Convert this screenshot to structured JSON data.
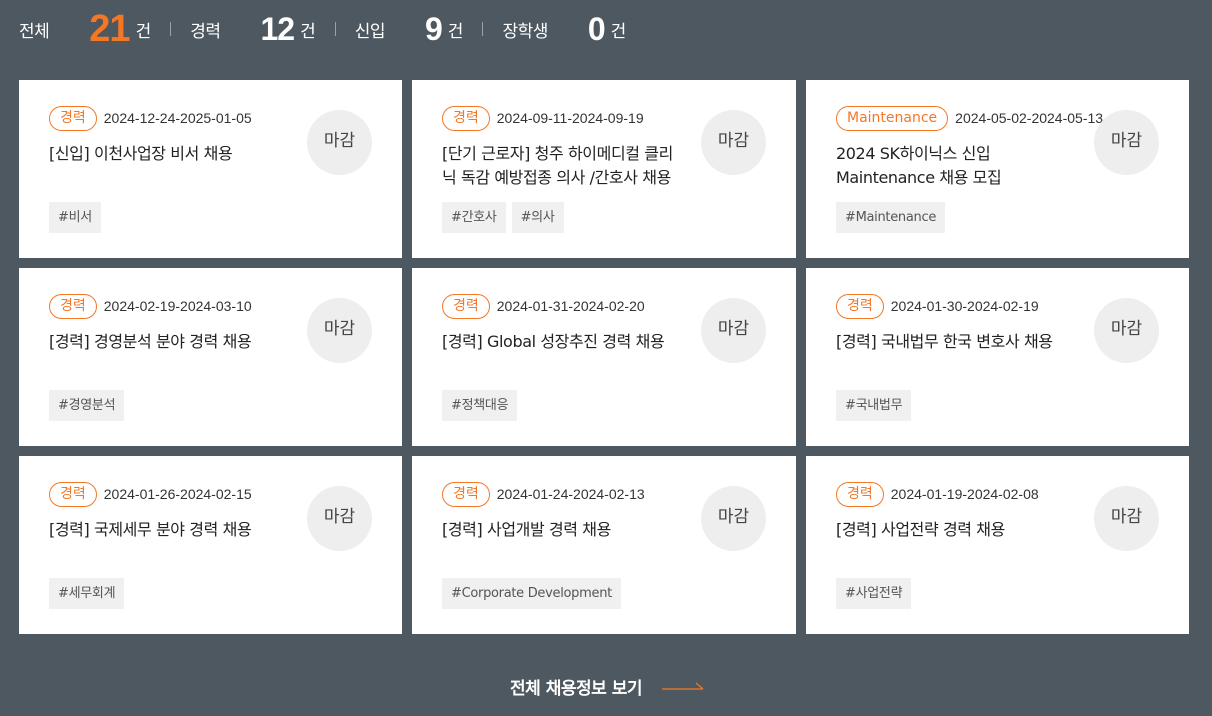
{
  "stats": [
    {
      "label": "전체",
      "count": "21",
      "unit": "건"
    },
    {
      "label": "경력",
      "count": "12",
      "unit": "건"
    },
    {
      "label": "신입",
      "count": "9",
      "unit": "건"
    },
    {
      "label": "장학생",
      "count": "0",
      "unit": "건"
    }
  ],
  "cards": [
    {
      "badge": "경력",
      "period": "2024-12-24-2025-01-05",
      "title": "[신입] 이천사업장 비서 채용",
      "tags": [
        "비서"
      ],
      "status": "마감"
    },
    {
      "badge": "경력",
      "period": "2024-09-11-2024-09-19",
      "title": "[단기 근로자] 청주 하이메디컬 클리닉 독감 예방접종 의사 /간호사 채용",
      "tags": [
        "간호사",
        "의사"
      ],
      "status": "마감"
    },
    {
      "badge": "Maintenance",
      "period": "2024-05-02-2024-05-13",
      "title": "2024 SK하이닉스 신입 Maintenance 채용 모집",
      "tags": [
        "Maintenance"
      ],
      "status": "마감"
    },
    {
      "badge": "경력",
      "period": "2024-02-19-2024-03-10",
      "title": "[경력] 경영분석 분야 경력 채용",
      "tags": [
        "경영분석"
      ],
      "status": "마감"
    },
    {
      "badge": "경력",
      "period": "2024-01-31-2024-02-20",
      "title": "[경력] Global 성장추진 경력 채용",
      "tags": [
        "정책대응"
      ],
      "status": "마감"
    },
    {
      "badge": "경력",
      "period": "2024-01-30-2024-02-19",
      "title": "[경력] 국내법무 한국 변호사 채용",
      "tags": [
        "국내법무"
      ],
      "status": "마감"
    },
    {
      "badge": "경력",
      "period": "2024-01-26-2024-02-15",
      "title": "[경력] 국제세무 분야 경력 채용",
      "tags": [
        "세무회계"
      ],
      "status": "마감"
    },
    {
      "badge": "경력",
      "period": "2024-01-24-2024-02-13",
      "title": "[경력] 사업개발 경력 채용",
      "tags": [
        "Corporate Development"
      ],
      "status": "마감"
    },
    {
      "badge": "경력",
      "period": "2024-01-19-2024-02-08",
      "title": "[경력] 사업전략 경력 채용",
      "tags": [
        "사업전략"
      ],
      "status": "마감"
    }
  ],
  "tag_prefix": "#",
  "more_label": "전체 채용정보 보기",
  "colors": {
    "accent": "#f47725",
    "background": "#4e5861"
  }
}
